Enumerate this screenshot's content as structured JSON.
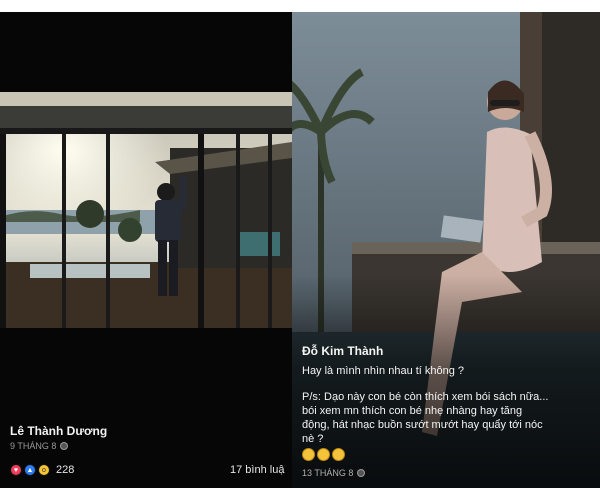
{
  "left_post": {
    "author": "Lê Thành Dương",
    "date": "9 THÁNG 8",
    "reaction_count": "228",
    "comments": "17 bình luậ",
    "reaction_icons": [
      "love-icon",
      "like-icon",
      "wow-icon"
    ]
  },
  "right_post": {
    "author": "Đỗ Kim Thành",
    "line1": "Hay là mình nhìn nhau tí không ?",
    "ps1": "P/s: Dạo này con bé còn thích xem bói sách nữa...",
    "ps2": "bói xem mn thích con bé nhẹ nhàng hay tăng",
    "ps3": "động, hát nhạc buồn sướt mướt hay quẩy tới nóc",
    "ps4": "nè ?",
    "emoji_icons": [
      "thinking-emoji",
      "thinking-emoji",
      "thinking-emoji"
    ],
    "date": "13 THÁNG 8"
  },
  "colors": {
    "background_left": "#060606",
    "background_right": "#141a20",
    "text": "#f2f2f2",
    "muted": "#9a9a9a",
    "love": "#f23d5c",
    "like": "#2d7cf6",
    "wow": "#f6c437"
  }
}
